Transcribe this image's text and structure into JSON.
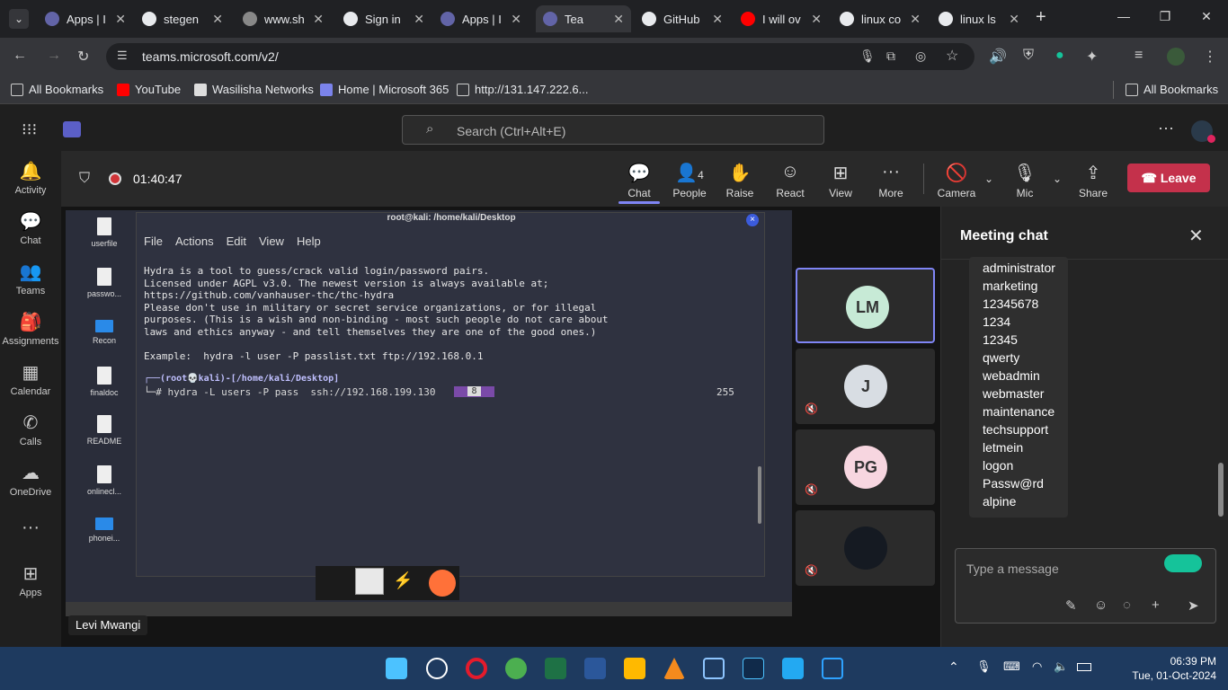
{
  "browser": {
    "tabs": [
      {
        "title": "Apps | I",
        "color": "#6264a7"
      },
      {
        "title": "stegen",
        "color": "#e8eaed"
      },
      {
        "title": "www.sh",
        "color": "#888888"
      },
      {
        "title": "Sign in",
        "color": "#e8eaed"
      },
      {
        "title": "Apps | I",
        "color": "#6264a7"
      },
      {
        "title": "Tea",
        "color": "#6264a7"
      },
      {
        "title": "GitHub",
        "color": "#e8eaed"
      },
      {
        "title": "I will ov",
        "color": "#ff0000"
      },
      {
        "title": "linux co",
        "color": "#e8eaed"
      },
      {
        "title": "linux ls",
        "color": "#e8eaed"
      }
    ],
    "url": "teams.microsoft.com/v2/",
    "bookmarks": [
      {
        "label": "All Bookmarks"
      },
      {
        "label": "YouTube"
      },
      {
        "label": "Wasilisha Networks"
      },
      {
        "label": "Home | Microsoft 365"
      },
      {
        "label": "http://131.147.222.6..."
      }
    ],
    "all_bookmarks_right": "All Bookmarks"
  },
  "teams": {
    "search_placeholder": "Search (Ctrl+Alt+E)",
    "rail": [
      "Activity",
      "Chat",
      "Teams",
      "Assignments",
      "Calendar",
      "Calls",
      "OneDrive",
      "Apps"
    ],
    "meeting": {
      "timer": "01:40:47",
      "controls": {
        "chat": "Chat",
        "people": "People",
        "people_count": "4",
        "raise": "Raise",
        "react": "React",
        "view": "View",
        "more": "More",
        "camera": "Camera",
        "mic": "Mic",
        "share": "Share",
        "leave": "Leave"
      }
    },
    "presenter_name": "Levi Mwangi",
    "participants": [
      {
        "initials": "LM",
        "color": "#c7ead6",
        "muted": false
      },
      {
        "initials": "J",
        "color": "#d8dde3",
        "muted": true
      },
      {
        "initials": "PG",
        "color": "#f7d6e0",
        "muted": true
      },
      {
        "initials": "",
        "color": "#151a22",
        "muted": true
      }
    ],
    "chat": {
      "title": "Meeting chat",
      "message_lines": [
        "administrator",
        "marketing",
        "12345678",
        "1234",
        "12345",
        "qwerty",
        "webadmin",
        "webmaster",
        "maintenance",
        "techsupport",
        "letmein",
        "logon",
        "Passw@rd",
        "alpine"
      ],
      "composer_placeholder": "Type a message"
    }
  },
  "shared_screen": {
    "desktop_icons": [
      "userfile",
      "passwo...",
      "Recon",
      "finaldoc",
      "README",
      "onlinecl...",
      "phonei..."
    ],
    "terminal": {
      "title": "root@kali: /home/kali/Desktop",
      "menu": [
        "File",
        "Actions",
        "Edit",
        "View",
        "Help"
      ],
      "output": "Hydra is a tool to guess/crack valid login/password pairs.\nLicensed under AGPL v3.0. The newest version is always available at;\nhttps://github.com/vanhauser-thc/thc-hydra\nPlease don't use in military or secret service organizations, or for illegal\npurposes. (This is a wish and non-binding - most such people do not care about\nlaws and ethics anyway - and tell themselves they are one of the good ones.)\n\nExample:  hydra -l user -P passlist.txt ftp://192.168.0.1",
      "prompt_line": "┌──(root💀kali)-[/home/kali/Desktop]",
      "command_line": "└─# hydra -L users -P pass  ssh://192.168.199.130",
      "cursor_box": "8",
      "right_number": "255"
    }
  },
  "system": {
    "time": "06:39 PM",
    "date": "Tue, 01-Oct-2024"
  }
}
